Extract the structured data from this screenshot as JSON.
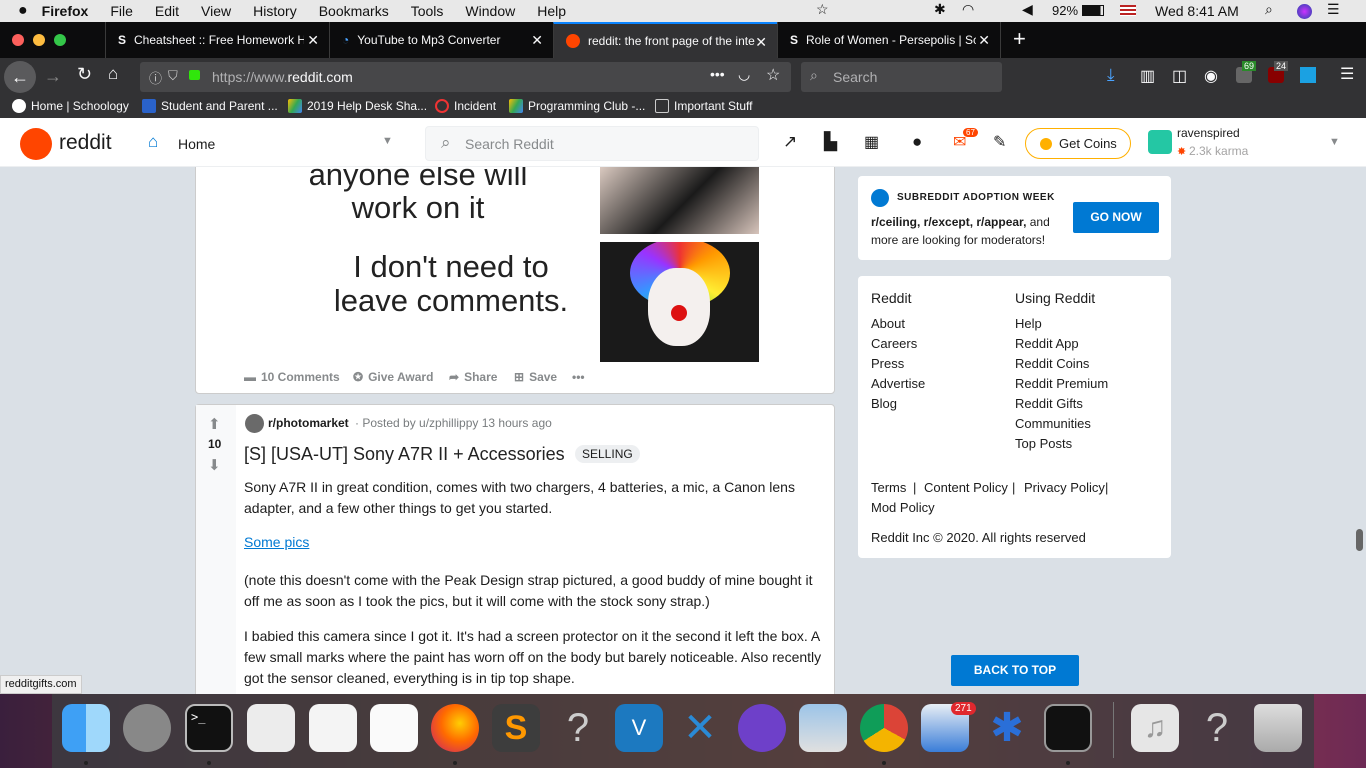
{
  "menubar": {
    "app": "Firefox",
    "items": [
      "File",
      "Edit",
      "View",
      "History",
      "Bookmarks",
      "Tools",
      "Window",
      "Help"
    ],
    "battery": "92%",
    "clock": "Wed 8:41 AM"
  },
  "tabs": [
    {
      "title": "Cheatsheet :: Free Homework H",
      "icon": "s-icon"
    },
    {
      "title": "YouTube to Mp3 Converter",
      "icon": "download-icon"
    },
    {
      "title": "reddit: the front page of the inte",
      "icon": "reddit-icon"
    },
    {
      "title": "Role of Women - Persepolis | Sc",
      "icon": "s-icon"
    }
  ],
  "nav": {
    "url_prefix": "https://www.",
    "url_domain": "reddit.com",
    "search_placeholder": "Search",
    "badge1": "69",
    "badge2": "24"
  },
  "bookmarks": [
    "Home | Schoology",
    "Student and Parent ...",
    "2019 Help Desk Sha...",
    "Incident",
    "Programming Club -...",
    "Important Stuff"
  ],
  "reddit": {
    "logo": "reddit",
    "home": "Home",
    "search_placeholder": "Search Reddit",
    "notif_count": "67",
    "get_coins": "Get Coins",
    "username": "ravenspired",
    "karma": "2.3k karma"
  },
  "meme": {
    "line1": "anyone else will",
    "line2": "work on it",
    "line3": "I don't need to",
    "line4": "leave comments."
  },
  "post1_actions": {
    "comments": "10 Comments",
    "award": "Give Award",
    "share": "Share",
    "save": "Save"
  },
  "post2": {
    "votes": "10",
    "subreddit": "r/photomarket",
    "posted_by": "· Posted by u/zphillippy 13 hours ago",
    "title": "[S] [USA-UT] Sony A7R II + Accessories",
    "flair": "SELLING",
    "p1": "Sony A7R II in great condition, comes with two chargers, 4 batteries, a mic, a Canon lens adapter, and a few other things to get you started.",
    "link": "Some pics",
    "p2": "(note this doesn't come with the Peak Design strap pictured, a good buddy of mine bought it off me as soon as I took the pics, but it will come with the stock sony strap.)",
    "p3": "I babied this camera since I got it. It's had a screen protector on it the second it left the box. A few small marks where the paint has worn off on the body but barely noticeable. Also recently got the sensor cleaned, everything is in tip top shape."
  },
  "adoption": {
    "heading": "SUBREDDIT ADOPTION WEEK",
    "bold": "r/ceiling, r/except, r/appear,",
    "rest": " and more are looking for moderators!",
    "button": "GO NOW"
  },
  "footer": {
    "col1_title": "Reddit",
    "col1": [
      "About",
      "Careers",
      "Press",
      "Advertise",
      "Blog"
    ],
    "col2_title": "Using Reddit",
    "col2": [
      "Help",
      "Reddit App",
      "Reddit Coins",
      "Reddit Premium",
      "Reddit Gifts",
      "Communities",
      "Top Posts"
    ],
    "legal": [
      "Terms",
      "Content Policy",
      "Privacy Policy",
      "Mod Policy"
    ],
    "copyright": "Reddit Inc © 2020. All rights reserved"
  },
  "back_to_top": "BACK TO TOP",
  "status_url": "redditgifts.com",
  "dock": {
    "mail_badge": "271"
  }
}
